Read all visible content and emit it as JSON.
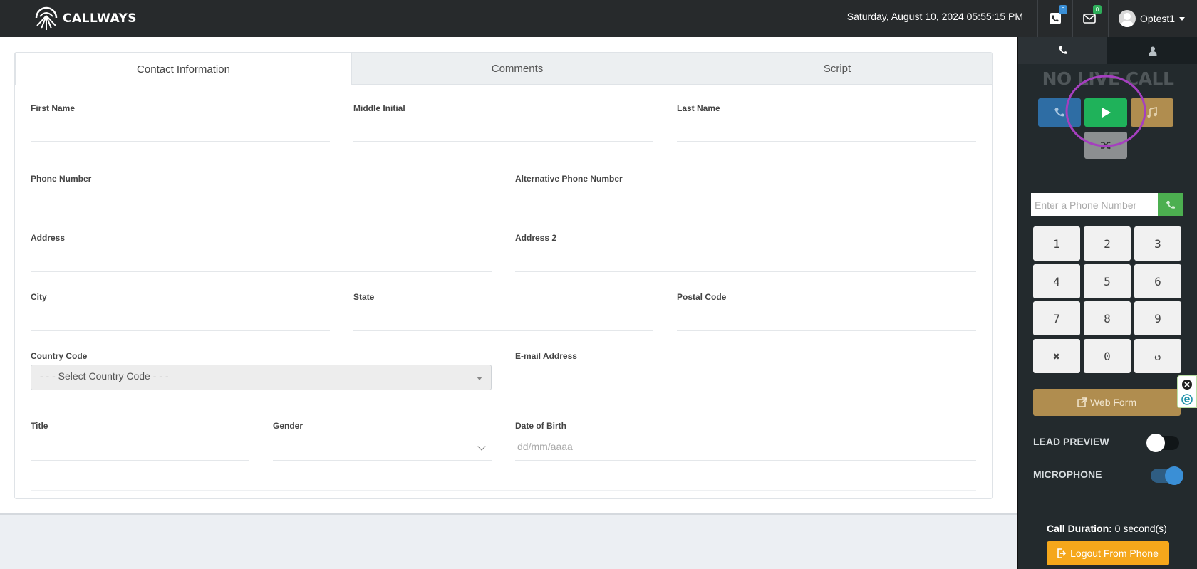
{
  "header": {
    "logo_text": "CALLWAYS",
    "datetime": "Saturday, August 10, 2024 05:55:15 PM",
    "calls_badge": "0",
    "messages_badge": "0",
    "user_name": "Optest1"
  },
  "tabs": [
    {
      "label": "Contact Information",
      "active": true
    },
    {
      "label": "Comments",
      "active": false
    },
    {
      "label": "Script",
      "active": false
    }
  ],
  "form": {
    "first_name": {
      "label": "First Name",
      "value": ""
    },
    "middle_initial": {
      "label": "Middle Initial",
      "value": ""
    },
    "last_name": {
      "label": "Last Name",
      "value": ""
    },
    "phone_number": {
      "label": "Phone Number",
      "value": ""
    },
    "alt_phone": {
      "label": "Alternative Phone Number",
      "value": ""
    },
    "address": {
      "label": "Address",
      "value": ""
    },
    "address2": {
      "label": "Address 2",
      "value": ""
    },
    "city": {
      "label": "City",
      "value": ""
    },
    "state": {
      "label": "State",
      "value": ""
    },
    "postal_code": {
      "label": "Postal Code",
      "value": ""
    },
    "country_code": {
      "label": "Country Code",
      "selected": "- - - Select Country Code - - -"
    },
    "email": {
      "label": "E-mail Address",
      "value": ""
    },
    "title": {
      "label": "Title",
      "value": ""
    },
    "gender": {
      "label": "Gender",
      "selected": ""
    },
    "dob": {
      "label": "Date of Birth",
      "placeholder": "dd/mm/aaaa"
    }
  },
  "panel": {
    "tabs": [
      {
        "icon": "phone-icon",
        "active": true
      },
      {
        "icon": "user-icon",
        "active": false
      }
    ],
    "status_text": "NO LIVE CALL",
    "controls": [
      {
        "icon": "phone-icon",
        "color": "#2e6da4"
      },
      {
        "icon": "play-icon",
        "color": "#1fb25a"
      },
      {
        "icon": "music-icon",
        "color": "#b08d4f"
      },
      {
        "icon": "shuffle-icon",
        "color": "#8c8f91"
      }
    ],
    "phone_input_placeholder": "Enter a Phone Number",
    "keypad": [
      "1",
      "2",
      "3",
      "4",
      "5",
      "6",
      "7",
      "8",
      "9",
      "✖",
      "0",
      "↺"
    ],
    "webform_label": "Web Form",
    "lead_preview_label": "LEAD PREVIEW",
    "lead_preview_on": false,
    "microphone_label": "MICROPHONE",
    "microphone_on": true,
    "call_duration_label": "Call Duration:",
    "call_duration_value": "0 second(s)",
    "logout_label": "Logout From Phone"
  },
  "colors": {
    "topbar": "#272a2c",
    "panel": "#232a2d",
    "accent_blue": "#3a8fd6",
    "accent_green": "#4caf50",
    "accent_orange": "#f5a71b",
    "highlight_circle": "#a53fbf"
  }
}
